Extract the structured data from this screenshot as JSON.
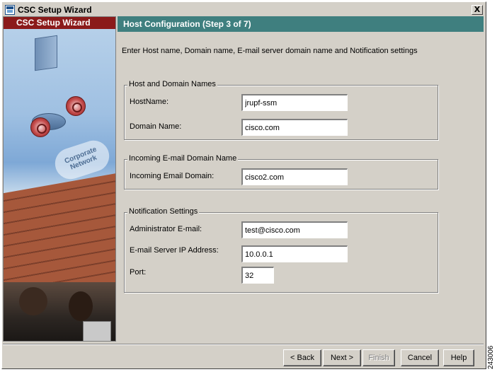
{
  "window": {
    "title": "CSC Setup Wizard",
    "close_label": "X"
  },
  "sidebar": {
    "header": "CSC Setup Wizard",
    "cloud_label": "Corporate Network"
  },
  "step": {
    "title": "Host Configuration  (Step 3 of 7)",
    "instructions": "Enter Host name, Domain name, E-mail server domain name and Notification settings"
  },
  "host_group": {
    "title": "Host and Domain Names",
    "hostname_label": "HostName:",
    "hostname_value": "jrupf-ssm",
    "domain_label": "Domain Name:",
    "domain_value": "cisco.com"
  },
  "email_group": {
    "title": "Incoming E-mail Domain Name",
    "incoming_label": "Incoming Email Domain:",
    "incoming_value": "cisco2.com"
  },
  "notify_group": {
    "title": "Notification Settings",
    "admin_label": "Administrator E-mail:",
    "admin_value": "test@cisco.com",
    "server_label": "E-mail Server IP Address:",
    "server_value": "10.0.0.1",
    "port_label": "Port:",
    "port_value": "32"
  },
  "buttons": {
    "back": "< Back",
    "next": "Next >",
    "finish": "Finish",
    "cancel": "Cancel",
    "help": "Help"
  },
  "figure_code": "243006",
  "colors": {
    "step_header_bg": "#3f7f7f",
    "sidebar_header_bg": "#8b1a1a",
    "window_bg": "#d4d0c8"
  }
}
